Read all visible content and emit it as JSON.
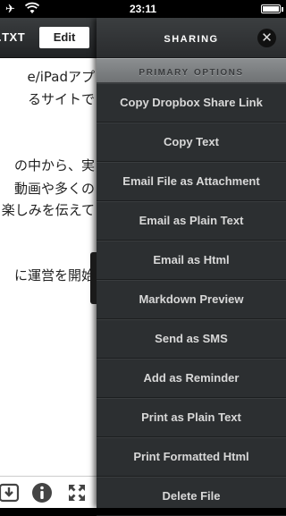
{
  "status_bar": {
    "time": "23:11",
    "airplane_icon": "airplane-icon",
    "wifi_icon": "wifi-icon",
    "battery_icon": "battery-icon"
  },
  "document": {
    "filename": ".TXT",
    "edit_label": "Edit",
    "lines": [
      "e/iPadアプ",
      "るサイトで",
      "の中から、実",
      "動画や多くの",
      "楽しみを伝えて",
      "に運営を開始"
    ],
    "footer_icons": [
      "download-icon",
      "info-icon",
      "expand-icon"
    ]
  },
  "sharing": {
    "title": "Sharing",
    "close_icon": "close-icon",
    "section_title": "Primary Options",
    "items": [
      "Copy Dropbox Share Link",
      "Copy Text",
      "Email File as Attachment",
      "Email as Plain Text",
      "Email as Html",
      "Markdown Preview",
      "Send as SMS",
      "Add as Reminder",
      "Print as Plain Text",
      "Print Formatted Html",
      "Delete File"
    ]
  }
}
